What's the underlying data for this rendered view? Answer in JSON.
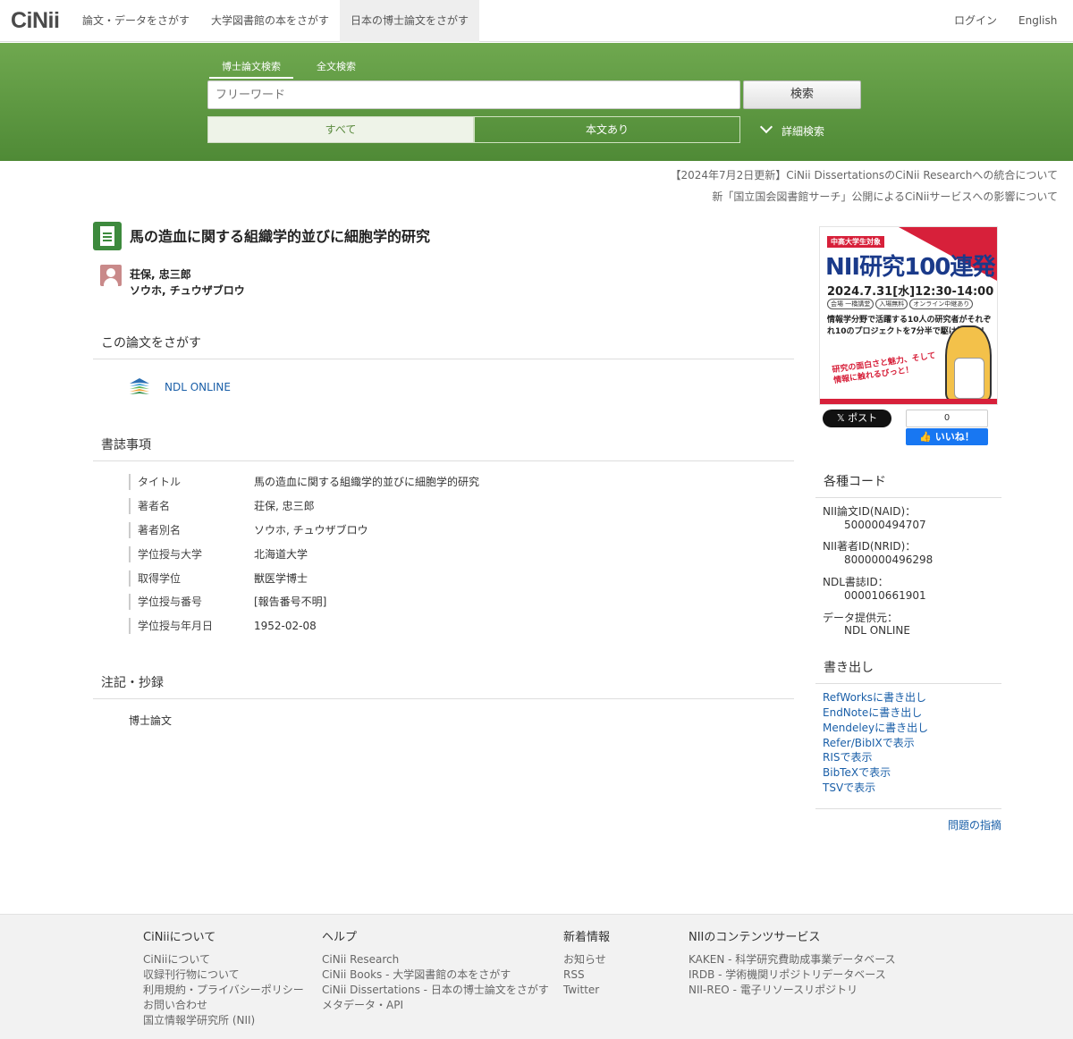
{
  "header": {
    "logo": "CiNii",
    "tabs": [
      {
        "label": "論文・データをさがす"
      },
      {
        "label": "大学図書館の本をさがす"
      },
      {
        "label": "日本の博士論文をさがす"
      }
    ],
    "login": "ログイン",
    "language": "English"
  },
  "search": {
    "tabs": [
      "博士論文検索",
      "全文検索"
    ],
    "placeholder": "フリーワード",
    "button": "検索",
    "filter_all": "すべて",
    "filter_body": "本文あり",
    "advanced": "詳細検索"
  },
  "notices": [
    "【2024年7月2日更新】CiNii DissertationsのCiNii Researchへの統合について",
    "新「国立国会図書館サーチ」公開によるCiNiiサービスへの影響について"
  ],
  "record": {
    "title": "馬の造血に関する組織学的並びに細胞学的研究",
    "author_name": "荘保, 忠三郎",
    "author_kana": "ソウホ, チュウザブロウ"
  },
  "find_section": {
    "heading": "この論文をさがす",
    "link": "NDL ONLINE"
  },
  "biblio": {
    "heading": "書誌事項",
    "rows": [
      {
        "label": "タイトル",
        "value": "馬の造血に関する組織学的並びに細胞学的研究"
      },
      {
        "label": "著者名",
        "value": "荘保, 忠三郎"
      },
      {
        "label": "著者別名",
        "value": "ソウホ, チュウザブロウ"
      },
      {
        "label": "学位授与大学",
        "value": "北海道大学"
      },
      {
        "label": "取得学位",
        "value": "獣医学博士"
      },
      {
        "label": "学位授与番号",
        "value": "[報告番号不明]"
      },
      {
        "label": "学位授与年月日",
        "value": "1952-02-08"
      }
    ]
  },
  "notes": {
    "heading": "注記・抄録",
    "text": "博士論文"
  },
  "banner": {
    "tag": "中高大学生対象",
    "title": "NII研究100連発",
    "date": "2024.7.31[水]12:30-14:00",
    "pills": [
      "会場 一橋講堂",
      "入場無料",
      "オンライン中継あり"
    ],
    "desc": "情報学分野で活躍する10人の研究者がそれぞれ10のプロジェクトを7分半で駆け抜ける！",
    "tagline": "研究の面白さと魅力、そして情報に触れるびっと！"
  },
  "social": {
    "x_post": "ポスト",
    "like_count": "0",
    "like_label": "いいね！"
  },
  "codes": {
    "heading": "各種コード",
    "items": [
      {
        "label": "NII論文ID(NAID)：",
        "value": "500000494707"
      },
      {
        "label": "NII著者ID(NRID)：",
        "value": "8000000496298"
      },
      {
        "label": "NDL書誌ID：",
        "value": "000010661901"
      },
      {
        "label": "データ提供元：",
        "value": "NDL ONLINE"
      }
    ]
  },
  "export": {
    "heading": "書き出し",
    "links": [
      "RefWorksに書き出し",
      "EndNoteに書き出し",
      "Mendeleyに書き出し",
      "Refer/BibIXで表示",
      "RISで表示",
      "BibTeXで表示",
      "TSVで表示"
    ],
    "report": "問題の指摘"
  },
  "footer": {
    "columns": [
      {
        "heading": "CiNiiについて",
        "links": [
          "CiNiiについて",
          "収録刊行物について",
          "利用規約・プライバシーポリシー",
          "お問い合わせ",
          "国立情報学研究所 (NII)"
        ]
      },
      {
        "heading": "ヘルプ",
        "links": [
          "CiNii Research",
          "CiNii Books - 大学図書館の本をさがす",
          "CiNii Dissertations - 日本の博士論文をさがす",
          "メタデータ・API"
        ]
      },
      {
        "heading": "新着情報",
        "links": [
          "お知らせ",
          "RSS",
          "Twitter"
        ]
      },
      {
        "heading": "NIIのコンテンツサービス",
        "links": [
          "KAKEN - 科学研究費助成事業データベース",
          "IRDB - 学術機関リポジトリデータベース",
          "NII-REO - 電子リソースリポジトリ"
        ]
      }
    ]
  },
  "colors": {
    "green_band": "#5a9a40",
    "link": "#1a5fa8",
    "doc_icon": "#3d8a3d"
  }
}
